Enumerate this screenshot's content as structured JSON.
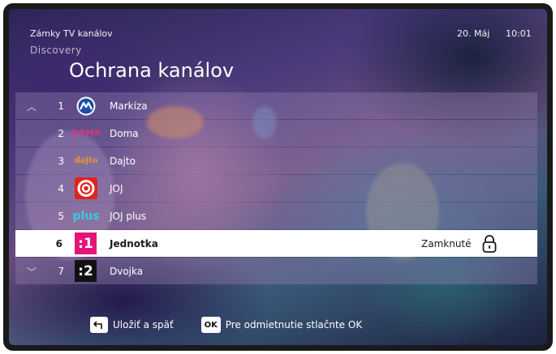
{
  "header": {
    "section_title": "Zámky TV kanálov",
    "channel_logo_text": "Discovery",
    "date": "20. Máj",
    "time": "10:01"
  },
  "page_title": "Ochrana kanálov",
  "channels": [
    {
      "number": "1",
      "name": "Markíza",
      "logo": "markiza-logo"
    },
    {
      "number": "2",
      "name": "Doma",
      "logo": "doma-logo",
      "logo_text": "DOMA"
    },
    {
      "number": "3",
      "name": "Dajto",
      "logo": "dajto-logo",
      "logo_text": "dajto"
    },
    {
      "number": "4",
      "name": "JOJ",
      "logo": "joj-logo"
    },
    {
      "number": "5",
      "name": "JOJ plus",
      "logo": "joj-plus-logo",
      "logo_text": "plus"
    },
    {
      "number": "6",
      "name": "Jednotka",
      "logo": "jednotka-logo",
      "logo_text": ":1",
      "status": "Zamknuté",
      "selected": true
    },
    {
      "number": "7",
      "name": "Dvojka",
      "logo": "dvojka-logo",
      "logo_text": ":2"
    }
  ],
  "footer": {
    "back_key_icon": "back-arrow-icon",
    "back_label": "Uložiť a späť",
    "ok_key": "OK",
    "ok_label": "Pre odmietnutie stlačnte OK"
  },
  "colors": {
    "selected_row": "#ffffff",
    "row_overlay": "rgba(150,130,180,0.38)",
    "markiza_blue": "#1e4fa8",
    "doma_pink": "#e0337a",
    "dajto_orange": "#f39a1c",
    "joj_red": "#e2231a",
    "joj_plus_cyan": "#3ec6e0",
    "jednotka_magenta": "#e3157a",
    "dvojka_black": "#111111"
  }
}
